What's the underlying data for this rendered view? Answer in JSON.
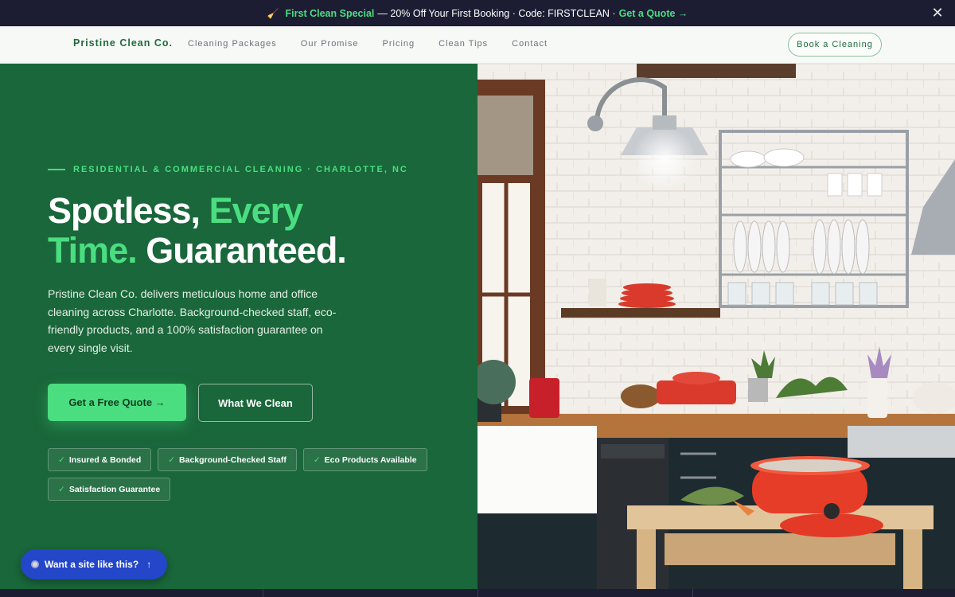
{
  "announcement": {
    "icon": "broom-icon",
    "highlight": "First Clean Special",
    "text": "— 20% Off Your First Booking · Code: FIRSTCLEAN ·",
    "cta": "Get a Quote →",
    "close_icon": "close-icon"
  },
  "nav": {
    "brand": "Pristine Clean Co.",
    "links": [
      "Cleaning Packages",
      "Our Promise",
      "Pricing",
      "Clean Tips",
      "Contact"
    ],
    "book_button": "Book a Cleaning"
  },
  "hero": {
    "eyebrow": "RESIDENTIAL & COMMERCIAL CLEANING · CHARLOTTE, NC",
    "headline_part1": "Spotless,",
    "headline_accent1": "Every",
    "headline_accent2": "Time.",
    "headline_part2": "Guaranteed.",
    "subtext": "Pristine Clean Co. delivers meticulous home and office cleaning across Charlotte. Background-checked staff, eco-friendly products, and a 100% satisfaction guarantee on every single visit.",
    "primary_button": "Get a Free Quote →",
    "secondary_button": "What We Clean",
    "badges": [
      "Insured & Bonded",
      "Background-Checked Staff",
      "Eco Products Available",
      "Satisfaction Guarantee"
    ],
    "badge_check": "✓"
  },
  "floating": {
    "site_button": "Want a site like this?",
    "site_arrow": "↑"
  },
  "colors": {
    "brand_green": "#19673a",
    "accent_green": "#4ade80",
    "dark_navy": "#1c1d33",
    "site_blue": "#2446c8"
  }
}
